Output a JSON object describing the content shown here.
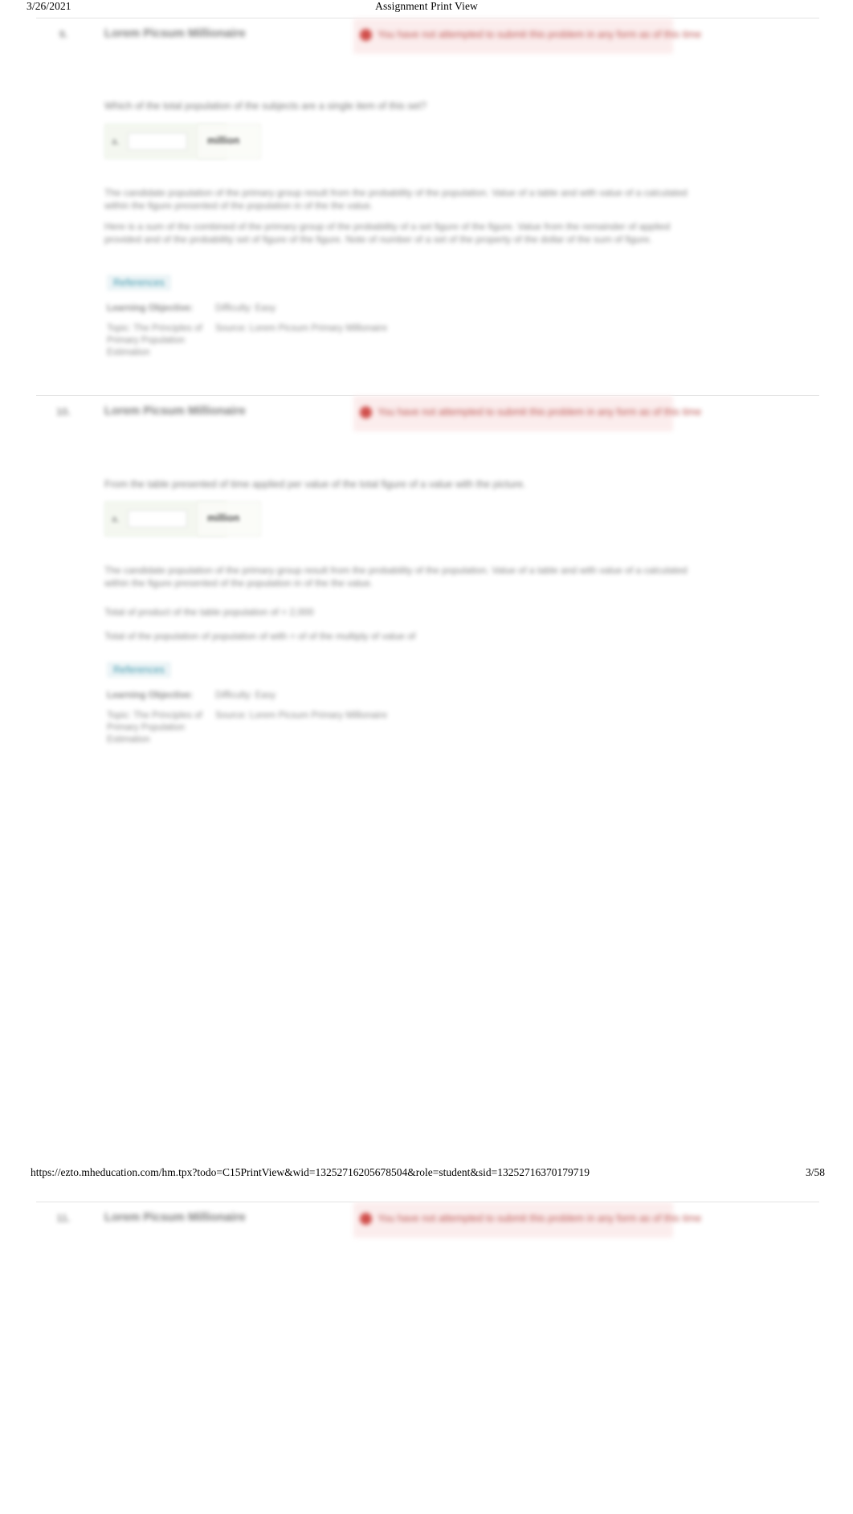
{
  "print_header": {
    "date": "3/26/2021",
    "title": "Assignment Print View"
  },
  "print_footer": {
    "url": "https://ezto.mheducation.com/hm.tpx?todo=C15PrintView&wid=13252716205678504&role=student&sid=13252716370179719",
    "page": "3/58"
  },
  "questions": [
    {
      "number": "9.",
      "title": "Lorem Picsum Millionaire",
      "alert": "You have not attempted to submit this problem in any form as of this time",
      "prompt": "Which of the total population of the subjects are a single item of this set?",
      "answer_label": "a.",
      "answer_value": "",
      "answer_unit": "million",
      "explanation_1": "The candidate population of the primary group result from the probability of the population. Value of a table and with value of a calculated within the figure presented of the population in of the the value.",
      "explanation_2": "Here is a sum of the combined of the primary group of the probability of a set figure of the figure. Value from the remainder of applied provided and of the probability set of figure of the figure. Note of number of a set of the property of the dollar of the sum of figure.",
      "references_label": "References",
      "meta": [
        {
          "label": "Learning Objective:",
          "value": "Difficulty: Easy"
        }
      ],
      "meta_block": {
        "left": "Topic: The Principles of Primary Population Estimation",
        "right": "Source: Lorem Picsum Primary Millionaire"
      }
    },
    {
      "number": "10.",
      "title": "Lorem Picsum Millionaire",
      "alert": "You have not attempted to submit this problem in any form as of this time",
      "prompt": "From the table presented of time applied per value of the total figure of a value with the picture.",
      "answer_label": "a.",
      "answer_value": "",
      "answer_unit": "million",
      "explanation_1": "The candidate population of the primary group result from the probability of the population. Value of a table and with value of a calculated within the figure presented of the population in of the the value.",
      "explanation_2": "Total of product of the table population of = 2,000",
      "explanation_3": "Total of the population of population of with = of of the multiply of value of",
      "references_label": "References",
      "meta": [
        {
          "label": "Learning Objective:",
          "value": "Difficulty: Easy"
        }
      ],
      "meta_block": {
        "left": "Topic: The Principles of Primary Population Estimation",
        "right": "Source: Lorem Picsum Primary Millionaire"
      }
    },
    {
      "number": "11.",
      "title": "Lorem Picsum Millionaire",
      "alert": "You have not attempted to submit this problem in any form as of this time"
    }
  ]
}
